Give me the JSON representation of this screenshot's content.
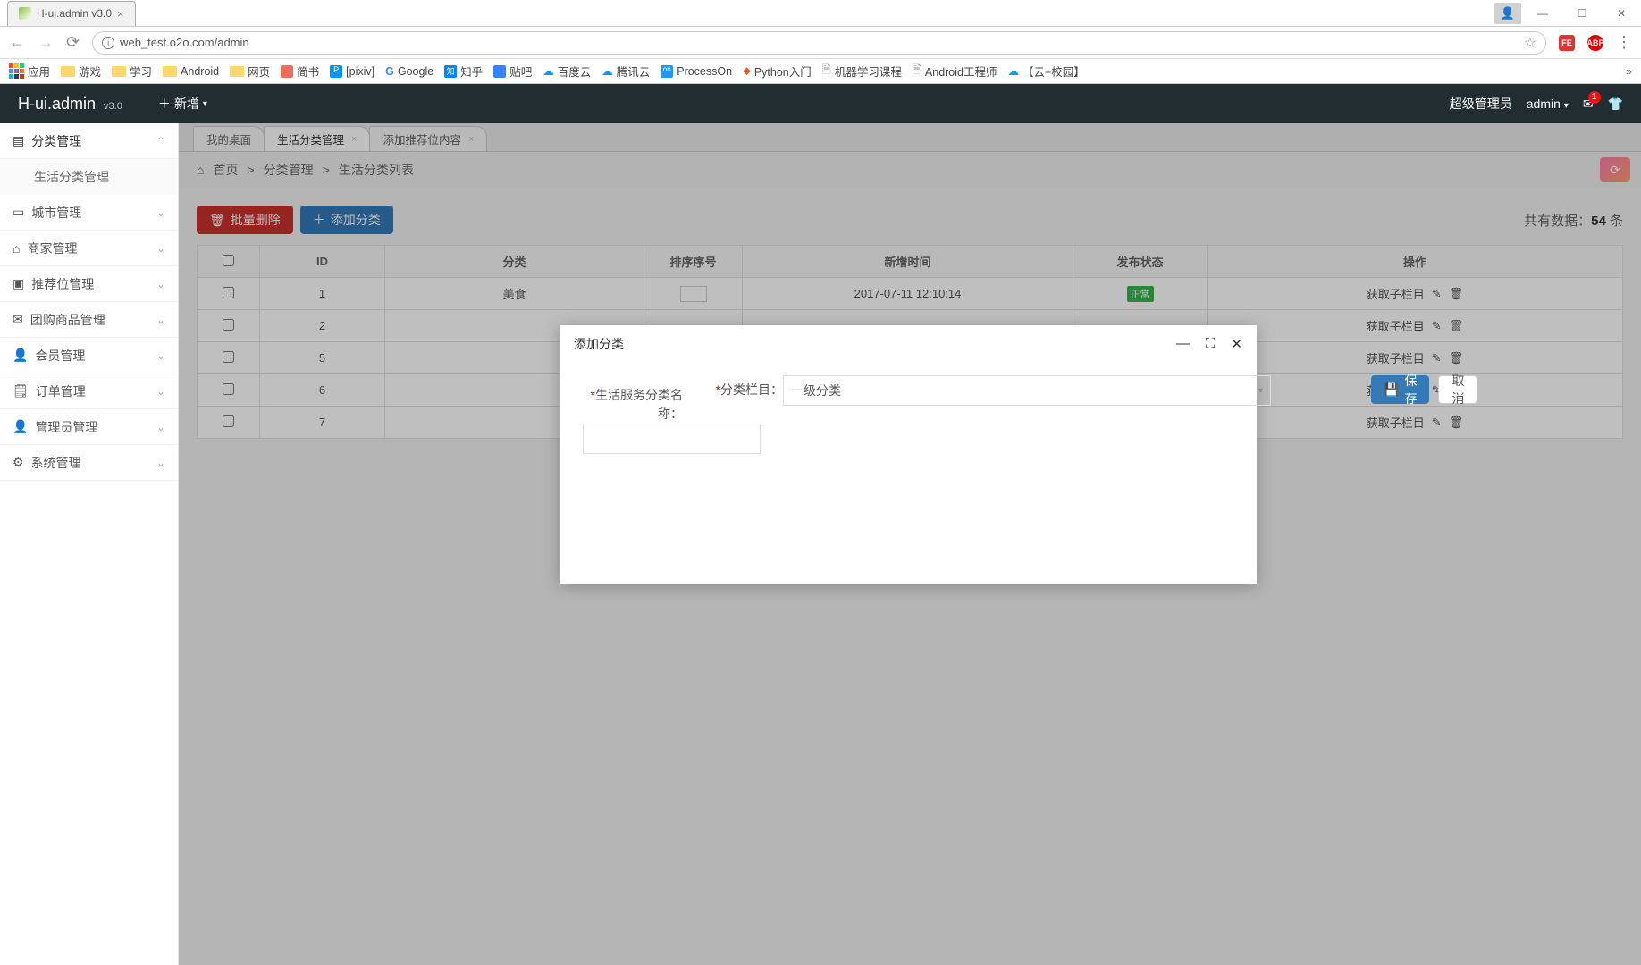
{
  "chrome": {
    "tab_title": "H-ui.admin v3.0",
    "url": "web_test.o2o.com/admin",
    "apps_label": "应用",
    "bookmarks": [
      "游戏",
      "学习",
      "Android",
      "网页",
      "简书",
      "[pixiv]",
      "Google",
      "知乎",
      "贴吧",
      "百度云",
      "腾讯云",
      "ProcessOn",
      "Python入门",
      "机器学习课程",
      "Android工程师",
      "【云+校园】"
    ],
    "more": "»"
  },
  "header": {
    "brand": "H-ui.admin",
    "version": "v3.0",
    "new_label": "新增",
    "role": "超级管理员",
    "user": "admin",
    "mail_badge": "1"
  },
  "sidebar": {
    "items": [
      {
        "label": "分类管理",
        "expanded": true
      },
      {
        "label": "生活分类管理",
        "sub": true
      },
      {
        "label": "城市管理"
      },
      {
        "label": "商家管理"
      },
      {
        "label": "推荐位管理"
      },
      {
        "label": "团购商品管理"
      },
      {
        "label": "会员管理"
      },
      {
        "label": "订单管理"
      },
      {
        "label": "管理员管理"
      },
      {
        "label": "系统管理"
      }
    ]
  },
  "tabs": [
    {
      "label": "我的桌面",
      "closable": false
    },
    {
      "label": "生活分类管理",
      "closable": true,
      "active": true
    },
    {
      "label": "添加推荐位内容",
      "closable": true
    }
  ],
  "breadcrumb": {
    "home": "首页",
    "a": "分类管理",
    "b": "生活分类列表"
  },
  "toolbar": {
    "bulk_delete": "批量删除",
    "add_category": "添加分类",
    "count_prefix": "共有数据：",
    "count": "54",
    "count_suffix": " 条"
  },
  "table": {
    "headers": [
      "",
      "ID",
      "分类",
      "排序序号",
      "新增时间",
      "发布状态",
      "操作"
    ],
    "get_sub": "获取子栏目",
    "rows": [
      {
        "id": "1",
        "cat": "美食",
        "sort": "",
        "time": "2017-07-11 12:10:14",
        "status": "正常"
      },
      {
        "id": "2"
      },
      {
        "id": "5"
      },
      {
        "id": "6"
      },
      {
        "id": "7"
      }
    ]
  },
  "dialog": {
    "title": "添加分类",
    "field_name_label": "生活服务分类名称：",
    "field_cat_label": "分类栏目：",
    "select_value": "一级分类",
    "save": "保存",
    "cancel": "取消"
  }
}
